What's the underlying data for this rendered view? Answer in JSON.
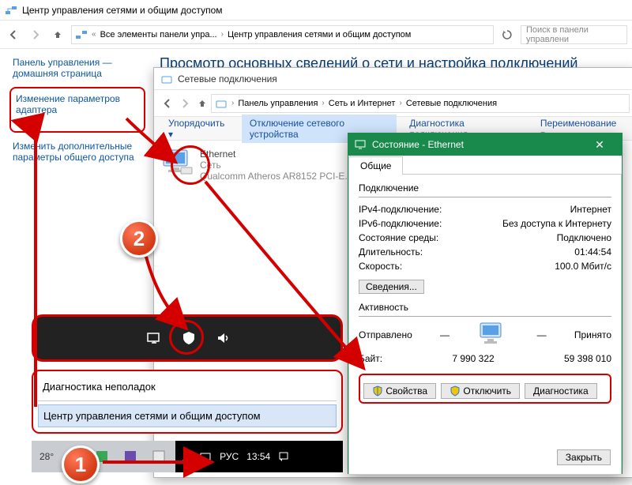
{
  "window": {
    "title": "Центр управления сетями и общим доступом"
  },
  "nav": {
    "crumb_root": "Все элементы панели упра...",
    "crumb_leaf": "Центр управления сетями и общим доступом",
    "search_placeholder": "Поиск в панели управлени"
  },
  "leftnav": {
    "home1": "Панель управления —",
    "home2": "домашняя страница",
    "link1a": "Изменение параметров",
    "link1b": "адаптера",
    "link2a": "Изменить дополнительные",
    "link2b": "параметры общего доступа"
  },
  "heading": "Просмотр основных сведений о сети и настройка подключений",
  "inner": {
    "title": "Сетевые подключения",
    "bc1": "Панель управления",
    "bc2": "Сеть и Интернет",
    "bc3": "Сетевые подключения",
    "tb1": "Упорядочить",
    "tb2": "Отключение сетевого устройства",
    "tb3": "Диагностика подключения",
    "tb4": "Переименование п",
    "conn_name": "Ethernet",
    "conn_net": "Сеть",
    "conn_dev": "Qualcomm Atheros AR8152 PCI-E..."
  },
  "dlg": {
    "title": "Состояние - Ethernet",
    "tab": "Общие",
    "grp_conn": "Подключение",
    "lbl_ipv4": "IPv4-подключение:",
    "val_ipv4": "Интернет",
    "lbl_ipv6": "IPv6-подключение:",
    "val_ipv6": "Без доступа к Интернету",
    "lbl_media": "Состояние среды:",
    "val_media": "Подключено",
    "lbl_dur": "Длительность:",
    "val_dur": "01:44:54",
    "lbl_speed": "Скорость:",
    "val_speed": "100.0 Мбит/с",
    "btn_details": "Сведения...",
    "grp_act": "Активность",
    "sent": "Отправлено",
    "recv": "Принято",
    "lbl_bytes": "Байт:",
    "bytes_sent": "7 990 322",
    "bytes_recv": "59 398 010",
    "btn_props": "Свойства",
    "btn_disable": "Отключить",
    "btn_diag": "Диагностика",
    "btn_close": "Закрыть"
  },
  "ctx": {
    "item1": "Диагностика неполадок",
    "item2": "Центр управления сетями и общим доступом"
  },
  "taskbar": {
    "temp": "28°",
    "lang": "РУС",
    "time": "13:54"
  },
  "badges": {
    "b1": "1",
    "b2": "2"
  }
}
